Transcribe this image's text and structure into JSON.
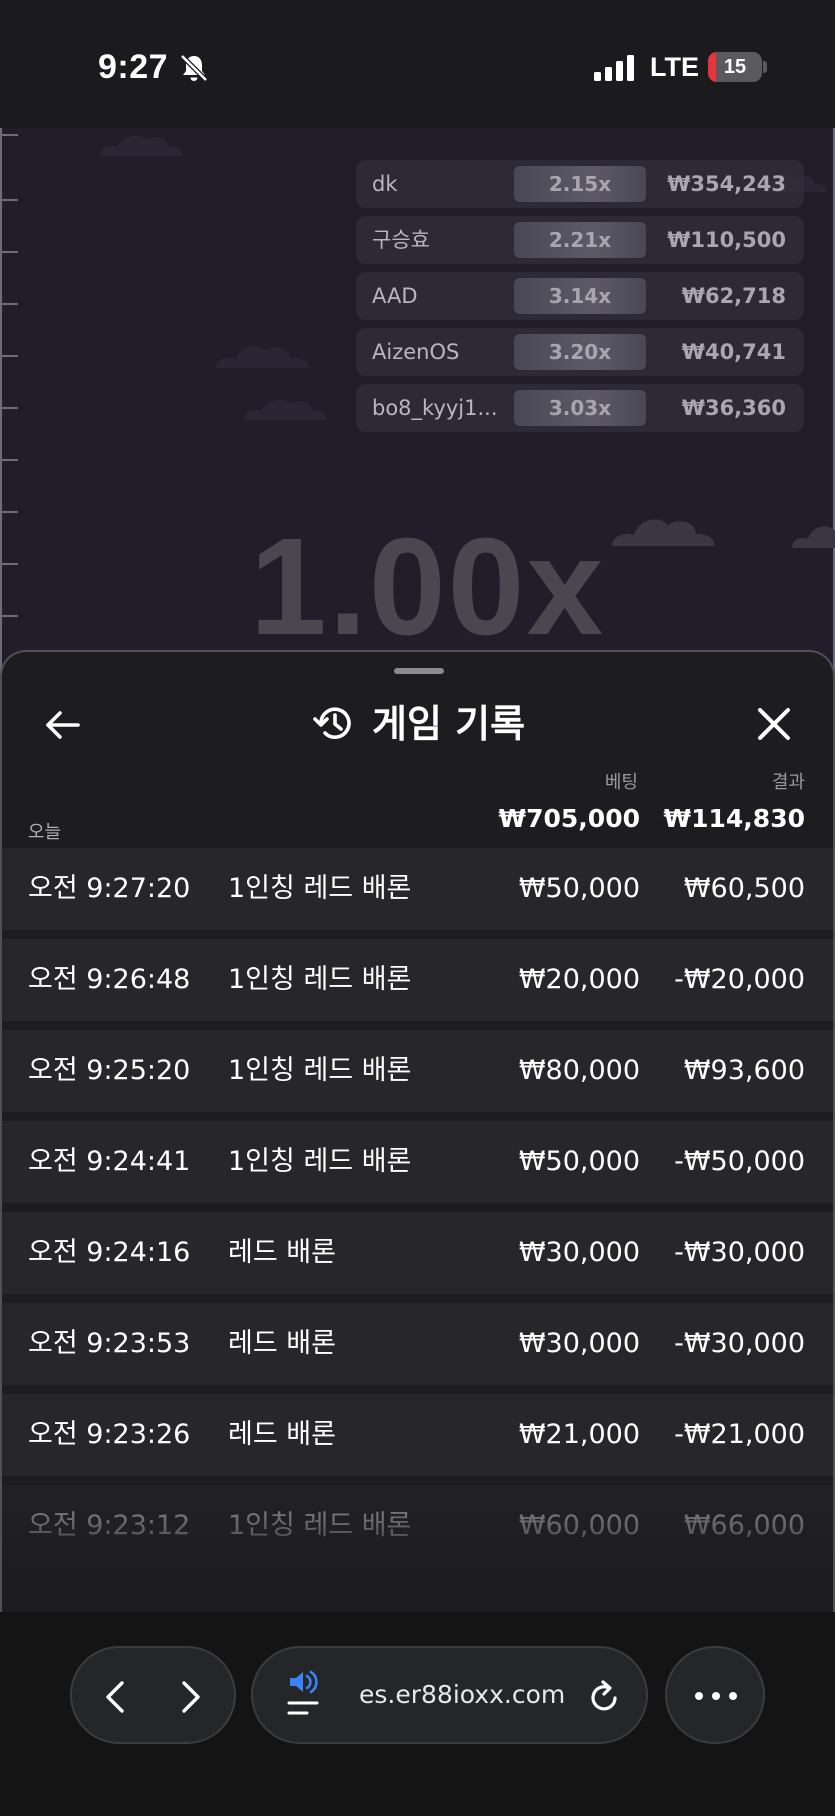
{
  "status_bar": {
    "time": "9:27",
    "network": "LTE",
    "battery_level": "15",
    "battery_fraction": 0.15,
    "battery_color": "#e5353b"
  },
  "game": {
    "multiplier": "1.00x",
    "bets": [
      {
        "player": "dk",
        "multiplier": "2.15x",
        "amount": "₩354,243"
      },
      {
        "player": "구승효",
        "multiplier": "2.21x",
        "amount": "₩110,500"
      },
      {
        "player": "AAD",
        "multiplier": "3.14x",
        "amount": "₩62,718"
      },
      {
        "player": "AizenOS",
        "multiplier": "3.20x",
        "amount": "₩40,741"
      },
      {
        "player": "bo8_kyyj1...",
        "multiplier": "3.03x",
        "amount": "₩36,360"
      }
    ]
  },
  "history": {
    "title": "게임 기록",
    "col_bet": "베팅",
    "col_result": "결과",
    "today_label": "오늘",
    "total_bet": "₩705,000",
    "total_result": "₩114,830",
    "rows": [
      {
        "time": "오전 9:27:20",
        "game": "1인칭 레드 배론",
        "bet": "₩50,000",
        "result": "₩60,500"
      },
      {
        "time": "오전 9:26:48",
        "game": "1인칭 레드 배론",
        "bet": "₩20,000",
        "result": "-₩20,000"
      },
      {
        "time": "오전 9:25:20",
        "game": "1인칭 레드 배론",
        "bet": "₩80,000",
        "result": "₩93,600"
      },
      {
        "time": "오전 9:24:41",
        "game": "1인칭 레드 배론",
        "bet": "₩50,000",
        "result": "-₩50,000"
      },
      {
        "time": "오전 9:24:16",
        "game": "레드 배론",
        "bet": "₩30,000",
        "result": "-₩30,000"
      },
      {
        "time": "오전 9:23:53",
        "game": "레드 배론",
        "bet": "₩30,000",
        "result": "-₩30,000"
      },
      {
        "time": "오전 9:23:26",
        "game": "레드 배론",
        "bet": "₩21,000",
        "result": "-₩21,000"
      },
      {
        "time": "오전 9:23:12",
        "game": "1인칭 레드 배론",
        "bet": "₩60,000",
        "result": "₩66,000"
      }
    ]
  },
  "browser": {
    "url": "es.er88ioxx.com",
    "load_progress": 0.03,
    "accent_color": "#3a82f7"
  },
  "icons": [
    "bell-off-icon",
    "signal-icon",
    "back-icon",
    "history-icon",
    "close-icon",
    "back-nav-icon",
    "forward-nav-icon",
    "speaker-icon",
    "reload-icon",
    "more-icon"
  ]
}
